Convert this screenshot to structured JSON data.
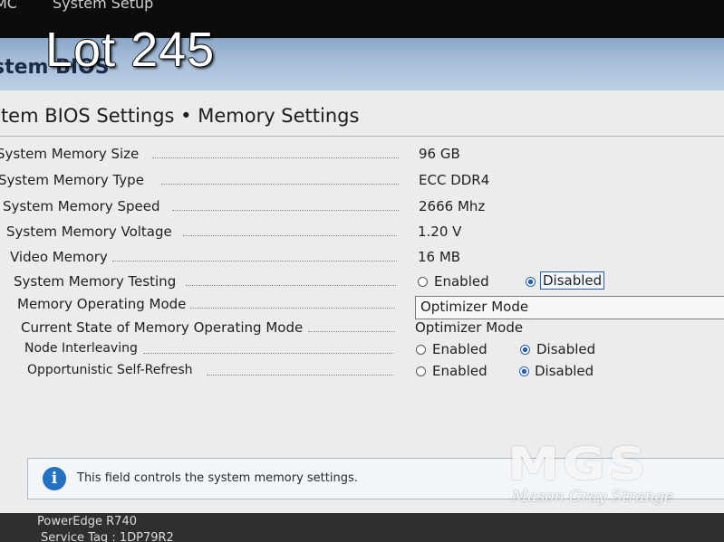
{
  "topbar": {
    "left_text": "MC",
    "setup_label": "System Setup"
  },
  "banner": {
    "title": "stem BIOS"
  },
  "page": {
    "title": "stem BIOS Settings • Memory Settings"
  },
  "settings": {
    "memory_size": {
      "label": "System Memory Size",
      "value": "96 GB"
    },
    "memory_type": {
      "label": "System Memory Type",
      "value": "ECC DDR4"
    },
    "memory_speed": {
      "label": "System Memory Speed",
      "value": "2666 Mhz"
    },
    "memory_voltage": {
      "label": "System Memory Voltage",
      "value": "1.20 V"
    },
    "video_memory": {
      "label": "Video Memory",
      "value": "16 MB"
    },
    "memory_testing": {
      "label": "System Memory Testing",
      "option_enabled": "Enabled",
      "option_disabled": "Disabled",
      "selected": "Disabled"
    },
    "operating_mode": {
      "label": "Memory Operating Mode",
      "value": "Optimizer Mode"
    },
    "current_mode": {
      "label": "Current State of Memory Operating Mode",
      "value": "Optimizer Mode"
    },
    "node_interleaving": {
      "label": "Node Interleaving",
      "option_enabled": "Enabled",
      "option_disabled": "Disabled",
      "selected": "Disabled"
    },
    "self_refresh": {
      "label": "Opportunistic Self-Refresh",
      "option_enabled": "Enabled",
      "option_disabled": "Disabled",
      "selected": "Disabled"
    }
  },
  "help": {
    "text": "This field controls the system memory settings."
  },
  "footer": {
    "model": "PowerEdge R740",
    "service_tag": "Service Tag : 1DP79R2"
  },
  "overlay": {
    "lot": "Lot 245",
    "watermark_logo": "MGS",
    "watermark_text": "Mason Gray Strange"
  }
}
